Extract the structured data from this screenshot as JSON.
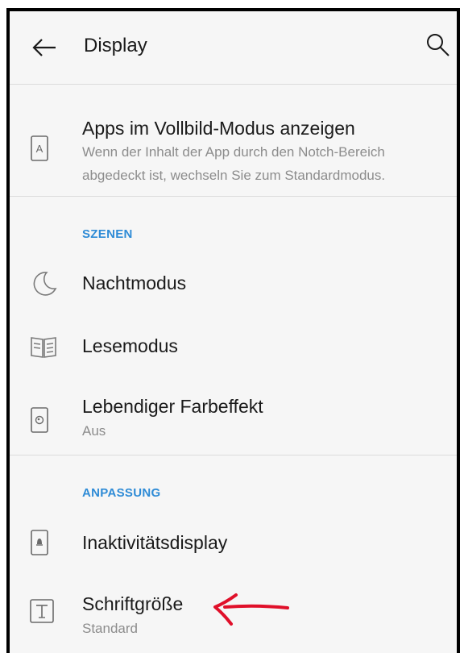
{
  "header": {
    "title": "Display"
  },
  "apps_fullscreen": {
    "label": "Apps im Vollbild-Modus anzeigen",
    "description_line1": "Wenn der Inhalt der App durch den Notch-Bereich",
    "description_line2": "abgedeckt ist, wechseln Sie zum Standardmodus.",
    "icon_letter": "A"
  },
  "sections": {
    "scenes": "SZENEN",
    "customization": "ANPASSUNG"
  },
  "items": {
    "night_mode": {
      "label": "Nachtmodus"
    },
    "reading_mode": {
      "label": "Lesemodus"
    },
    "vivid_color": {
      "label": "Lebendiger Farbeffekt",
      "value": "Aus"
    },
    "ambient_display": {
      "label": "Inaktivitätsdisplay"
    },
    "font_size": {
      "label": "Schriftgröße",
      "value": "Standard"
    }
  },
  "colors": {
    "accent": "#2e8bd6",
    "annotation_arrow": "#e0102a"
  }
}
